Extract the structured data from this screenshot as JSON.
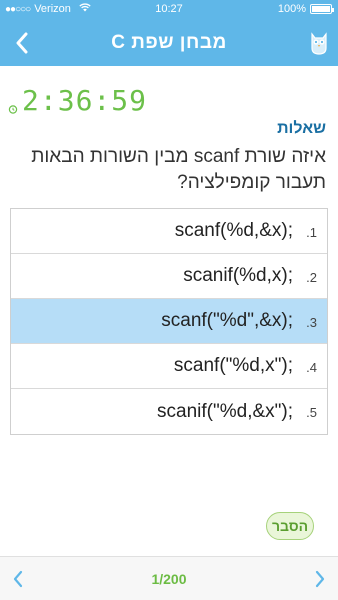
{
  "status_bar": {
    "carrier": "Verizon",
    "signal_dots": "●●○○○",
    "time": "10:27",
    "battery": "100%"
  },
  "nav": {
    "title": "מבחן שפת C",
    "back_icon": "chevron-left-icon",
    "owl_icon": "owl-icon"
  },
  "timer": {
    "value": "2:36:59",
    "color": "#6cc04a"
  },
  "section": {
    "title": "שאלות"
  },
  "question": {
    "text": "איזה שורת scanf מבין השורות הבאות תעבור קומפילציה?"
  },
  "answers": [
    {
      "number": ".1",
      "code": "scanf(%d,&x);",
      "selected": false
    },
    {
      "number": ".2",
      "code": "scanif(%d,x);",
      "selected": false
    },
    {
      "number": ".3",
      "code": "scanf(\"%d\",&x);",
      "selected": true
    },
    {
      "number": ".4",
      "code": "scanf(\"%d,x\");",
      "selected": false
    },
    {
      "number": ".5",
      "code": "scanif(\"%d,&x\");",
      "selected": false
    }
  ],
  "explain_button": {
    "label": "הסבר"
  },
  "pager": {
    "counter": "1/200"
  },
  "colors": {
    "header": "#5fb7e8",
    "selected_answer": "#b6ddf7",
    "accent_green": "#6cc04a",
    "section_title": "#1a6fa3"
  }
}
